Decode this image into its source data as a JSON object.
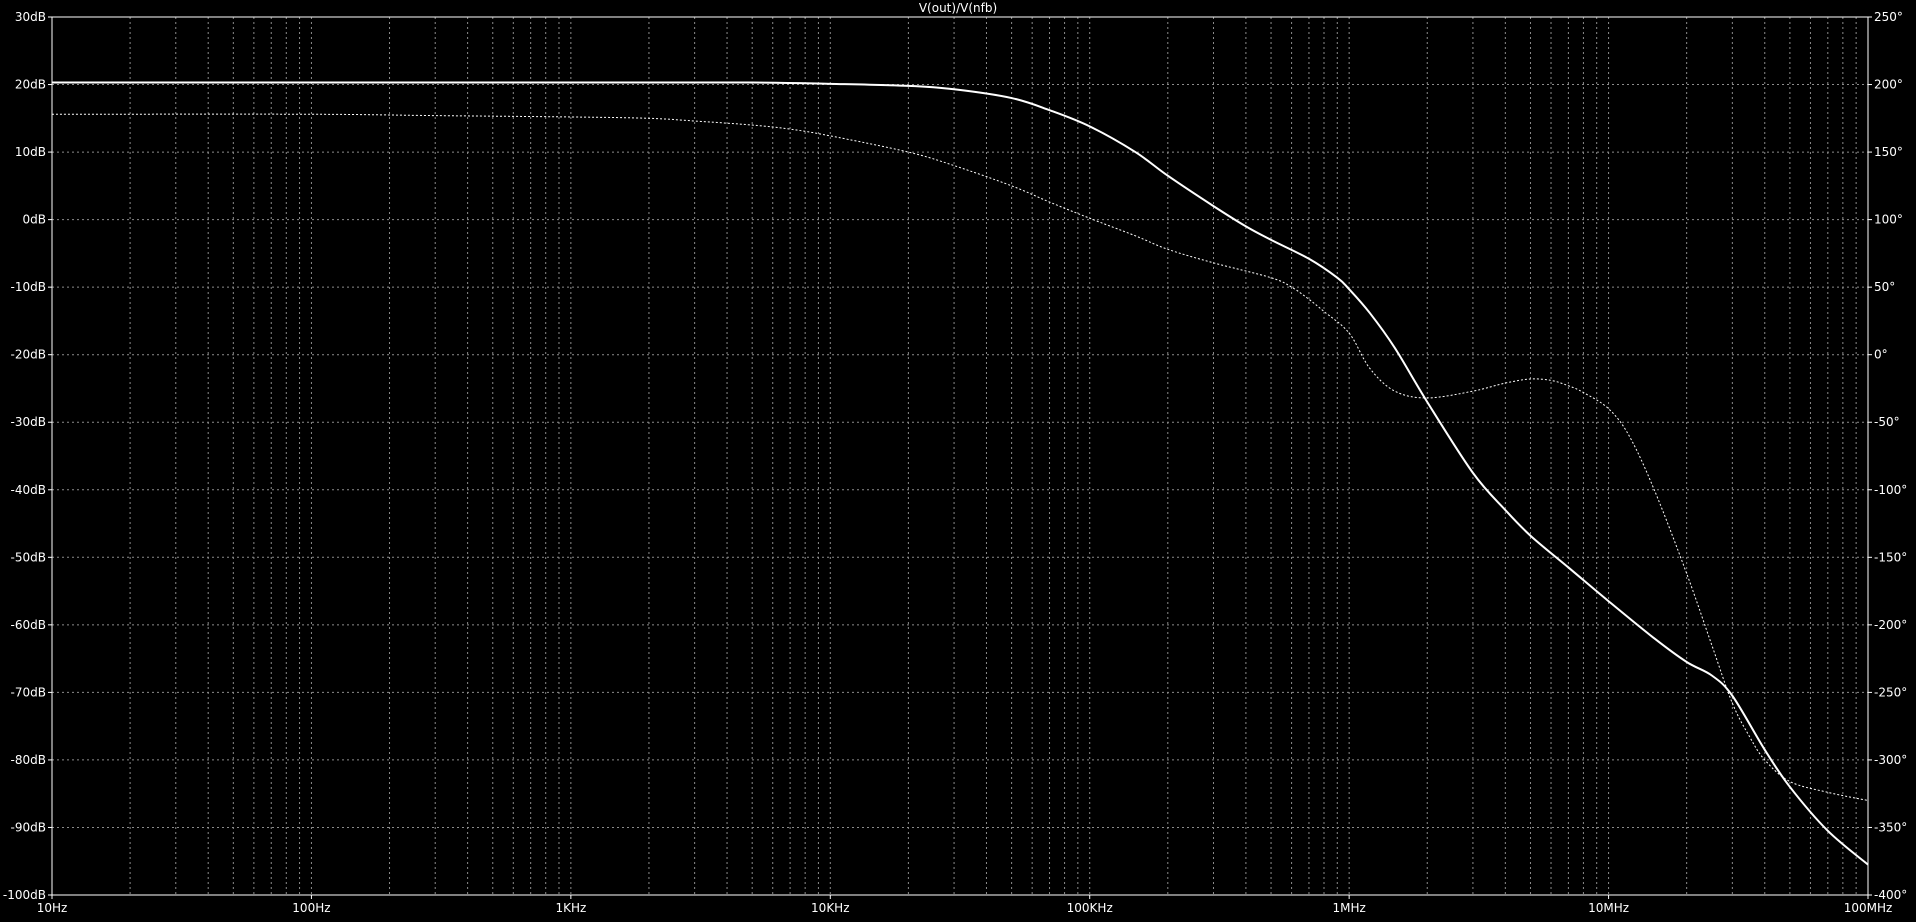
{
  "chart_data": {
    "type": "line",
    "title": "V(out)/V(nfb)",
    "x_scale": "log",
    "xlim": [
      10,
      100000000
    ],
    "x_ticks": [
      {
        "value": 10,
        "label": "10Hz"
      },
      {
        "value": 100,
        "label": "100Hz"
      },
      {
        "value": 1000,
        "label": "1KHz"
      },
      {
        "value": 10000,
        "label": "10KHz"
      },
      {
        "value": 100000,
        "label": "100KHz"
      },
      {
        "value": 1000000,
        "label": "1MHz"
      },
      {
        "value": 10000000,
        "label": "10MHz"
      },
      {
        "value": 100000000,
        "label": "100MHz"
      }
    ],
    "ylim_left": [
      -100,
      30
    ],
    "y_ticks_left": [
      {
        "value": 30,
        "label": "30dB"
      },
      {
        "value": 20,
        "label": "20dB"
      },
      {
        "value": 10,
        "label": "10dB"
      },
      {
        "value": 0,
        "label": "0dB"
      },
      {
        "value": -10,
        "label": "-10dB"
      },
      {
        "value": -20,
        "label": "-20dB"
      },
      {
        "value": -30,
        "label": "-30dB"
      },
      {
        "value": -40,
        "label": "-40dB"
      },
      {
        "value": -50,
        "label": "-50dB"
      },
      {
        "value": -60,
        "label": "-60dB"
      },
      {
        "value": -70,
        "label": "-70dB"
      },
      {
        "value": -80,
        "label": "-80dB"
      },
      {
        "value": -90,
        "label": "-90dB"
      },
      {
        "value": -100,
        "label": "-100dB"
      }
    ],
    "ylim_right": [
      -400,
      250
    ],
    "y_ticks_right": [
      {
        "value": 250,
        "label": "250°"
      },
      {
        "value": 200,
        "label": "200°"
      },
      {
        "value": 150,
        "label": "150°"
      },
      {
        "value": 100,
        "label": "100°"
      },
      {
        "value": 50,
        "label": "50°"
      },
      {
        "value": 0,
        "label": "0°"
      },
      {
        "value": -50,
        "label": "-50°"
      },
      {
        "value": -100,
        "label": "-100°"
      },
      {
        "value": -150,
        "label": "-150°"
      },
      {
        "value": -200,
        "label": "-200°"
      },
      {
        "value": -250,
        "label": "-250°"
      },
      {
        "value": -300,
        "label": "-300°"
      },
      {
        "value": -350,
        "label": "-350°"
      },
      {
        "value": -400,
        "label": "-400°"
      }
    ],
    "grid": true,
    "colors": {
      "background": "#000000",
      "trace": "#ffffff",
      "grid": "#8c8c8c",
      "text": "#ffffff"
    },
    "series": [
      {
        "axis": "left",
        "style": "solid",
        "points": [
          [
            10,
            20.3
          ],
          [
            100,
            20.3
          ],
          [
            1000,
            20.3
          ],
          [
            5000,
            20.3
          ],
          [
            10000,
            20.1
          ],
          [
            20000,
            19.8
          ],
          [
            30000,
            19.3
          ],
          [
            50000,
            18.0
          ],
          [
            70000,
            16.2
          ],
          [
            100000,
            13.8
          ],
          [
            150000,
            10.0
          ],
          [
            200000,
            6.5
          ],
          [
            300000,
            2.0
          ],
          [
            400000,
            -1.0
          ],
          [
            500000,
            -3.0
          ],
          [
            700000,
            -5.8
          ],
          [
            900000,
            -8.6
          ],
          [
            1000000,
            -10.3
          ],
          [
            1200000,
            -13.8
          ],
          [
            1500000,
            -19.0
          ],
          [
            2000000,
            -27.0
          ],
          [
            3000000,
            -37.5
          ],
          [
            4000000,
            -43.0
          ],
          [
            5000000,
            -46.8
          ],
          [
            7000000,
            -51.5
          ],
          [
            10000000,
            -56.5
          ],
          [
            15000000,
            -62.0
          ],
          [
            20000000,
            -65.5
          ],
          [
            25000000,
            -67.5
          ],
          [
            30000000,
            -70.5
          ],
          [
            40000000,
            -78.5
          ],
          [
            50000000,
            -84.0
          ],
          [
            70000000,
            -90.5
          ],
          [
            100000000,
            -95.5
          ]
        ]
      },
      {
        "axis": "right",
        "style": "dotted",
        "points": [
          [
            10,
            178
          ],
          [
            100,
            178
          ],
          [
            300,
            177
          ],
          [
            1000,
            176
          ],
          [
            2000,
            175
          ],
          [
            3000,
            173
          ],
          [
            5000,
            170
          ],
          [
            7000,
            167
          ],
          [
            10000,
            162
          ],
          [
            20000,
            150
          ],
          [
            30000,
            140
          ],
          [
            50000,
            125
          ],
          [
            70000,
            113
          ],
          [
            100000,
            101
          ],
          [
            150000,
            88
          ],
          [
            200000,
            78
          ],
          [
            300000,
            68
          ],
          [
            500000,
            57
          ],
          [
            600000,
            50
          ],
          [
            700000,
            41
          ],
          [
            800000,
            32
          ],
          [
            1000000,
            16
          ],
          [
            1200000,
            -10
          ],
          [
            1500000,
            -27
          ],
          [
            2000000,
            -32
          ],
          [
            3000000,
            -27
          ],
          [
            4000000,
            -21
          ],
          [
            5000000,
            -18
          ],
          [
            6000000,
            -19
          ],
          [
            7000000,
            -23
          ],
          [
            8000000,
            -28
          ],
          [
            10000000,
            -40
          ],
          [
            12000000,
            -60
          ],
          [
            15000000,
            -100
          ],
          [
            20000000,
            -162
          ],
          [
            25000000,
            -215
          ],
          [
            30000000,
            -258
          ],
          [
            35000000,
            -283
          ],
          [
            40000000,
            -300
          ],
          [
            50000000,
            -316
          ],
          [
            70000000,
            -324
          ],
          [
            100000000,
            -330
          ]
        ]
      }
    ]
  }
}
